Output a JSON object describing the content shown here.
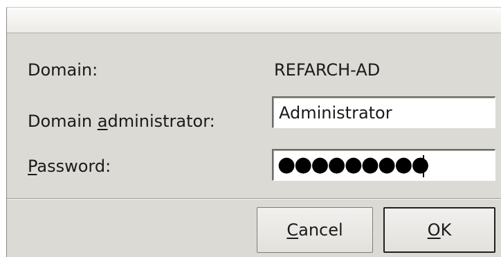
{
  "form": {
    "domain_label": "Domain:",
    "domain_value": "REFARCH-AD",
    "admin_label_pre": "Domain ",
    "admin_label_mnemonic": "a",
    "admin_label_post": "dministrator:",
    "admin_value": "Administrator",
    "password_label_mnemonic": "P",
    "password_label_post": "assword:",
    "password_masked": "●●●●●●●●●"
  },
  "buttons": {
    "cancel_mnemonic": "C",
    "cancel_rest": "ancel",
    "ok_mnemonic": "O",
    "ok_rest": "K"
  }
}
